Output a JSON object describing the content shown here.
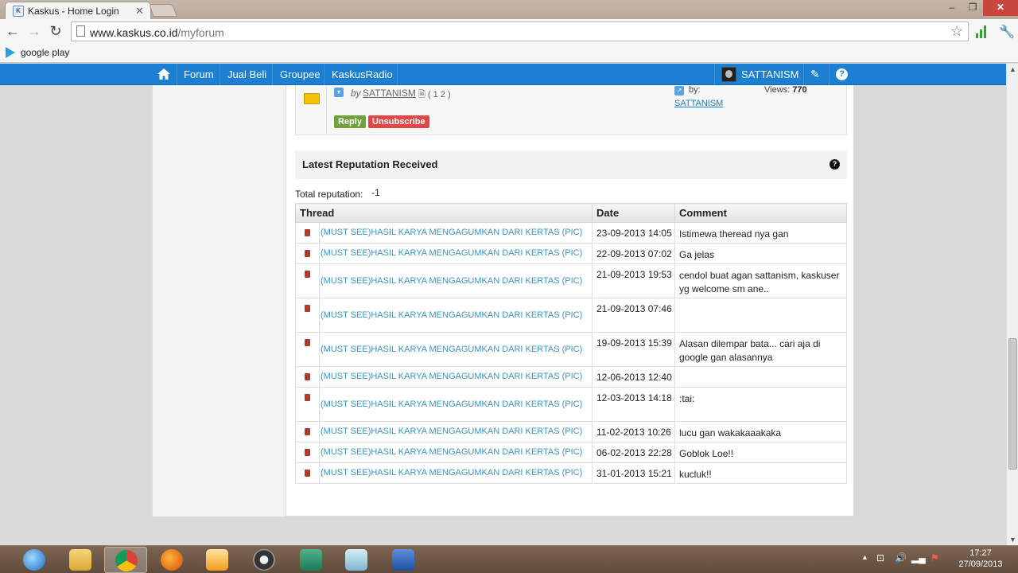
{
  "browser": {
    "tab_title": "Kaskus - Home Login",
    "url_domain": "www.kaskus.co.id",
    "url_path": "/myforum",
    "bookmark": "google play"
  },
  "navbar": {
    "items": [
      "Forum",
      "Jual Beli",
      "Groupee",
      "KaskusRadio"
    ],
    "username": "SATTANISM"
  },
  "thread_card": {
    "by": "by",
    "author": "SATTANISM",
    "pages": "( 1 2 )",
    "reply_label": "Reply",
    "unsubscribe_label": "Unsubscribe",
    "last_post_by": "by:",
    "last_post_user": "SATTANISM",
    "views_label": "Views:",
    "views_value": "770"
  },
  "reputation": {
    "title": "Latest Reputation Received",
    "total_label": "Total reputation:",
    "total_value": "-1",
    "columns": [
      "Thread",
      "Date",
      "Comment"
    ],
    "rows": [
      {
        "thread": "(MUST SEE)HASIL KARYA MENGAGUMKAN DARI KERTAS (PIC)",
        "date": "23-09-2013 14:05",
        "comment": "Istimewa theread nya gan"
      },
      {
        "thread": "(MUST SEE)HASIL KARYA MENGAGUMKAN DARI KERTAS (PIC)",
        "date": "22-09-2013 07:02",
        "comment": "Ga jelas"
      },
      {
        "thread": "(MUST SEE)HASIL KARYA MENGAGUMKAN DARI KERTAS (PIC)",
        "date": "21-09-2013 19:53",
        "comment": "cendol buat agan sattanism, kaskuser yg welcome sm ane.."
      },
      {
        "thread": "(MUST SEE)HASIL KARYA MENGAGUMKAN DARI KERTAS (PIC)",
        "date": "21-09-2013 07:46",
        "comment": ""
      },
      {
        "thread": "(MUST SEE)HASIL KARYA MENGAGUMKAN DARI KERTAS (PIC)",
        "date": "19-09-2013 15:39",
        "comment": "Alasan dilempar bata... cari aja di google gan alasannya"
      },
      {
        "thread": "(MUST SEE)HASIL KARYA MENGAGUMKAN DARI KERTAS (PIC)",
        "date": "12-06-2013 12:40",
        "comment": ""
      },
      {
        "thread": "(MUST SEE)HASIL KARYA MENGAGUMKAN DARI KERTAS (PIC)",
        "date": "12-03-2013 14:18",
        "comment": ":tai:"
      },
      {
        "thread": "(MUST SEE)HASIL KARYA MENGAGUMKAN DARI KERTAS (PIC)",
        "date": "11-02-2013 10:26",
        "comment": "lucu gan wakakaaakaka"
      },
      {
        "thread": "(MUST SEE)HASIL KARYA MENGAGUMKAN DARI KERTAS (PIC)",
        "date": "06-02-2013 22:28",
        "comment": "Goblok Loe!!"
      },
      {
        "thread": "(MUST SEE)HASIL KARYA MENGAGUMKAN DARI KERTAS (PIC)",
        "date": "31-01-2013 15:21",
        "comment": "kucluk!!"
      }
    ]
  },
  "taskbar": {
    "apps": [
      "internet-explorer-icon",
      "file-explorer-icon",
      "chrome-icon",
      "firefox-icon",
      "media-player-icon",
      "camera-app-icon",
      "publisher-icon",
      "notes-app-icon",
      "word-icon"
    ],
    "time": "17:27",
    "date": "27/09/2013"
  },
  "colors": {
    "navbar": "#1c7fd2",
    "thread_link": "#3a95c8",
    "reply_button": "#6fa33a",
    "unsubscribe_button": "#e04848"
  }
}
